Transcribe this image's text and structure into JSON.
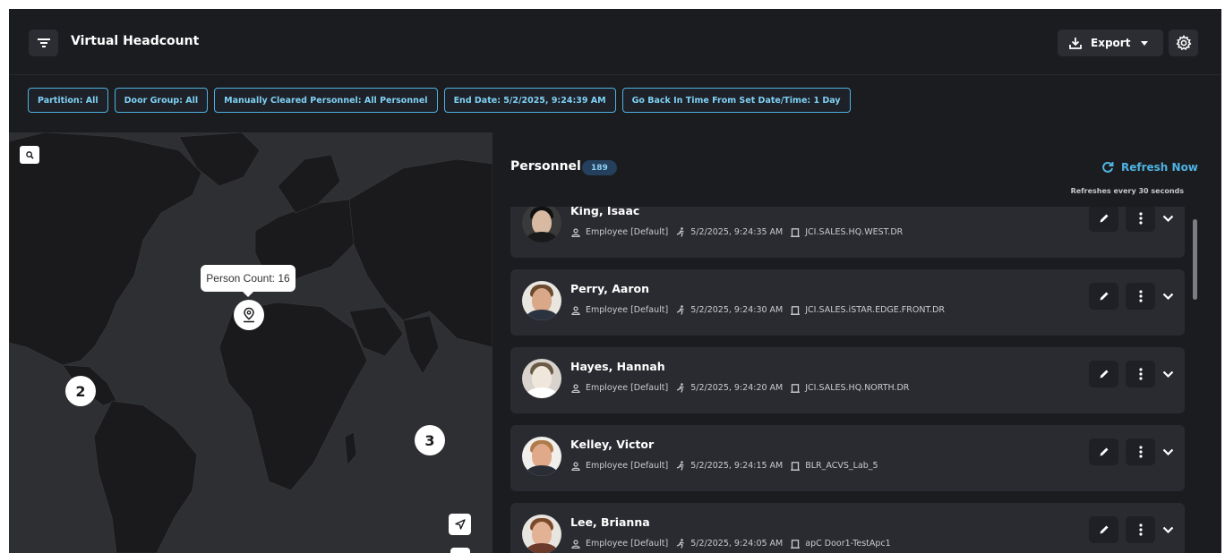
{
  "header": {
    "title": "Virtual Headcount",
    "export_label": "Export",
    "icons": {
      "filter": "filter-icon",
      "export": "download-icon",
      "settings": "gear-icon"
    }
  },
  "filters": [
    "Partition: All",
    "Door Group: All",
    "Manually Cleared Personnel: All Personnel",
    "End Date: 5/2/2025, 9:24:39 AM",
    "Go Back In Time From Set Date/Time: 1 Day"
  ],
  "map": {
    "tooltip": "Person Count: 16",
    "clusters": [
      "2",
      "3"
    ]
  },
  "personnel": {
    "title": "Personnel",
    "count": "189",
    "refresh_label": "Refresh Now",
    "refresh_note": "Refreshes every 30 seconds",
    "items": [
      {
        "name": "King, Isaac",
        "type": "Employee [Default]",
        "time": "5/2/2025, 9:24:35 AM",
        "door": "JCI.SALES.HQ.WEST.DR"
      },
      {
        "name": "Perry, Aaron",
        "type": "Employee [Default]",
        "time": "5/2/2025, 9:24:30 AM",
        "door": "JCI.SALES.iSTAR.EDGE.FRONT.DR"
      },
      {
        "name": "Hayes, Hannah",
        "type": "Employee [Default]",
        "time": "5/2/2025, 9:24:20 AM",
        "door": "JCI.SALES.HQ.NORTH.DR"
      },
      {
        "name": "Kelley, Victor",
        "type": "Employee [Default]",
        "time": "5/2/2025, 9:24:15 AM",
        "door": "BLR_ACVS_Lab_5"
      },
      {
        "name": "Lee, Brianna",
        "type": "Employee [Default]",
        "time": "5/2/2025, 9:24:05 AM",
        "door": "apC Door1-TestApc1"
      }
    ]
  },
  "colors": {
    "background": "#1b1c20",
    "card": "#2a2b31",
    "accent": "#4fb2e0",
    "map": "#2e2f33"
  }
}
